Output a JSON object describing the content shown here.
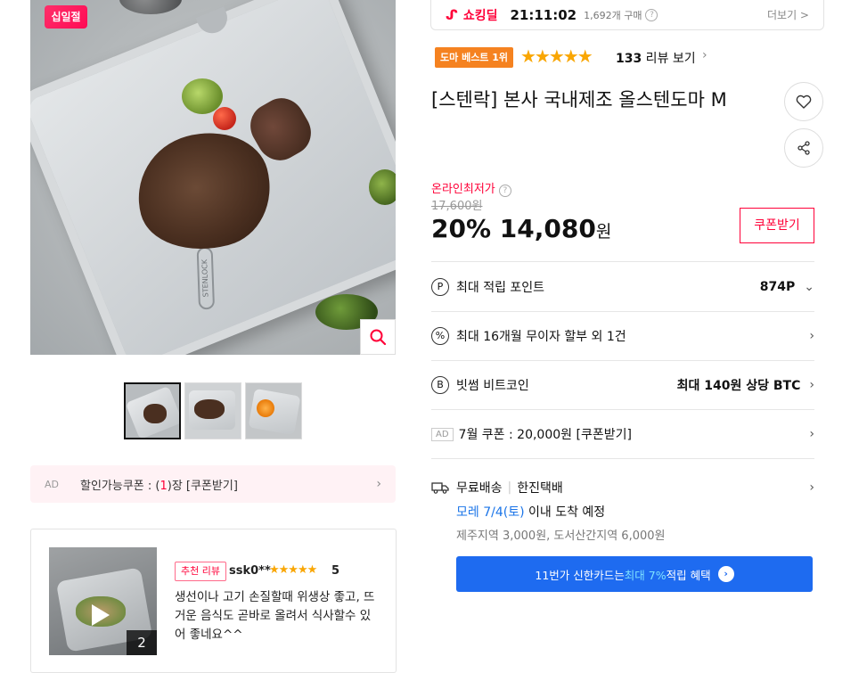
{
  "gallery": {
    "sale_badge": "십일절",
    "thumb_count": 3,
    "board_logo_text": "STENLOCK"
  },
  "coupon_bar": {
    "ad": "AD",
    "prefix": "할인가능쿠폰 : (",
    "count": "1",
    "suffix": ")장 [쿠폰받기]"
  },
  "review": {
    "tag": "추천 리뷰",
    "user": "ssk0**",
    "stars": "★★★★★",
    "score": "5",
    "photo_count": "2",
    "text": "생선이나 고기 손질할때 위생상 좋고, 뜨거운 음식도 곧바로 올려서 식사할수 있어 좋네요^^"
  },
  "deal": {
    "name": "쇼킹딜",
    "time": "21:11:02",
    "count": "1,692개 구매",
    "more": "더보기 >"
  },
  "product": {
    "best_badge": "도마 베스트 1위",
    "rating_stars": "★★★★★",
    "rating": 4.5,
    "review_count": "133",
    "review_label": " 리뷰 보기",
    "title": "[스텐락] 본사 국내제조 올스텐도마 M"
  },
  "price": {
    "lowest_label": "온라인최저가",
    "original": "17,600원",
    "discount": "20%",
    "final": "14,080",
    "unit": "원",
    "coupon_button": "쿠폰받기"
  },
  "benefits": {
    "points_label": "최대 적립 포인트",
    "points_value": "874P",
    "installment_label": "최대 16개월 무이자 할부 외 1건",
    "bitcoin_label": "빗썸 비트코인",
    "bitcoin_value": "최대 140원 상당 BTC",
    "ad_label": "AD",
    "coupon_label": "7월 쿠폰 : 20,000원 [쿠폰받기]"
  },
  "shipping": {
    "free": "무료배송",
    "carrier": "한진택배",
    "eta_highlight": "모레 7/4(토)",
    "eta_rest": " 이내 도착 예정",
    "extra": "제주지역 3,000원, 도서산간지역 6,000원"
  },
  "card_banner": {
    "prefix": "11번가 신한카드는 ",
    "highlight": "최대 7%",
    "suffix": " 적립 혜택"
  },
  "colors": {
    "accent": "#ff0038",
    "blue": "#1e6bf0",
    "best": "#f58220",
    "star": "#f9a603"
  }
}
